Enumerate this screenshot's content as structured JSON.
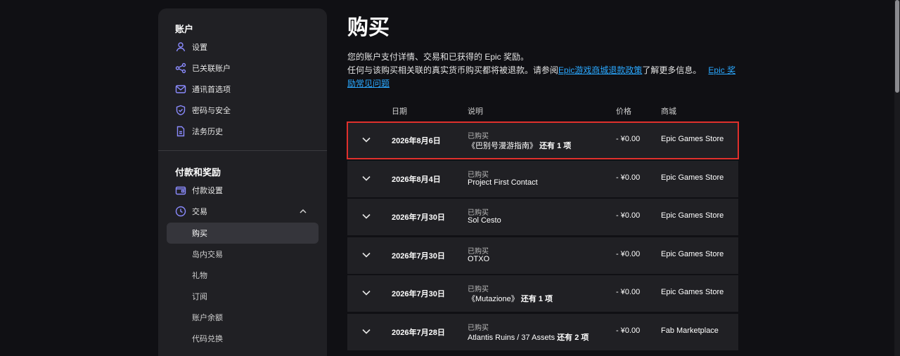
{
  "sidebar": {
    "account_title": "账户",
    "account_items": [
      {
        "label": "设置",
        "icon": "user-icon"
      },
      {
        "label": "已关联账户",
        "icon": "share-icon"
      },
      {
        "label": "通讯首选项",
        "icon": "mail-icon"
      },
      {
        "label": "密码与安全",
        "icon": "shield-icon"
      },
      {
        "label": "法务历史",
        "icon": "document-icon"
      }
    ],
    "payments_title": "付款和奖励",
    "payments_items": [
      {
        "label": "付款设置",
        "icon": "wallet-icon"
      },
      {
        "label": "交易",
        "icon": "clock-icon"
      }
    ],
    "transaction_subitems": [
      "购买",
      "岛内交易",
      "礼物",
      "订阅",
      "账户余额",
      "代码兑换"
    ],
    "active_subitem": "购买"
  },
  "main": {
    "title": "购买",
    "desc_line1": "您的账户支付详情、交易和已获得的 Epic 奖励。",
    "desc_line2_prefix": "任何与该购买相关联的真实货币购买都将被退款。请参阅",
    "desc_link1": "Epic游戏商城退款政策",
    "desc_mid": "了解更多信息。",
    "desc_link2": "Epic 奖励常见问题",
    "columns": {
      "date": "日期",
      "desc": "说明",
      "price": "价格",
      "store": "商城"
    }
  },
  "rows": [
    {
      "date": "2026年8月6日",
      "status": "已购买",
      "item": "《巴别号漫游指南》",
      "extra": "还有 1 项",
      "price": "- ¥0.00",
      "store": "Epic Games Store",
      "highlighted": true
    },
    {
      "date": "2026年8月4日",
      "status": "已购买",
      "item": "Project First Contact",
      "extra": "",
      "price": "- ¥0.00",
      "store": "Epic Games Store",
      "highlighted": false
    },
    {
      "date": "2026年7月30日",
      "status": "已购买",
      "item": "Sol Cesto",
      "extra": "",
      "price": "- ¥0.00",
      "store": "Epic Games Store",
      "highlighted": false
    },
    {
      "date": "2026年7月30日",
      "status": "已购买",
      "item": "OTXO",
      "extra": "",
      "price": "- ¥0.00",
      "store": "Epic Games Store",
      "highlighted": false
    },
    {
      "date": "2026年7月30日",
      "status": "已购买",
      "item": "《Mutazione》",
      "extra": "还有 1 项",
      "price": "- ¥0.00",
      "store": "Epic Games Store",
      "highlighted": false
    },
    {
      "date": "2026年7月28日",
      "status": "已购买",
      "item": "Atlantis Ruins / 37 Assets",
      "extra": "还有 2 项",
      "price": "- ¥0.00",
      "store": "Fab Marketplace",
      "highlighted": false
    }
  ],
  "colors": {
    "highlight": "#e0302c",
    "link": "#2aa8ff",
    "icon": "#8b8bff"
  }
}
